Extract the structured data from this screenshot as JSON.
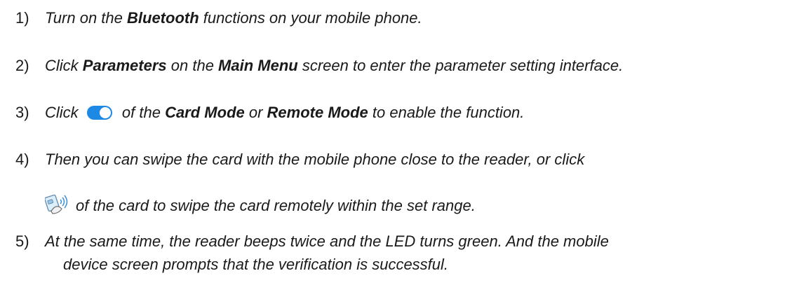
{
  "steps": [
    {
      "num": "1)",
      "parts": [
        "Turn on the ",
        "Bluetooth",
        " functions on your mobile phone."
      ]
    },
    {
      "num": "2)",
      "parts": [
        "Click ",
        "Parameters",
        " on the ",
        "Main Menu",
        " screen to enter the parameter setting interface."
      ]
    },
    {
      "num": "3)",
      "parts": [
        "Click ",
        " of the ",
        "Card Mode",
        " or ",
        "Remote Mode",
        " to enable the function."
      ]
    },
    {
      "num": "4)",
      "line1": "Then you can swipe the card with the mobile phone close to the reader, or click",
      "line2": "of the card to swipe the card remotely within the set range."
    },
    {
      "num": "5)",
      "line1": "At the same time, the reader beeps twice and the LED turns green. And the mobile",
      "line2": "device screen prompts that the verification is successful."
    }
  ],
  "icons": {
    "toggle": "toggle-switch-on-icon",
    "nfc": "nfc-card-swipe-icon"
  },
  "colors": {
    "toggle_accent": "#1e88e5",
    "text": "#1a1a1a"
  }
}
